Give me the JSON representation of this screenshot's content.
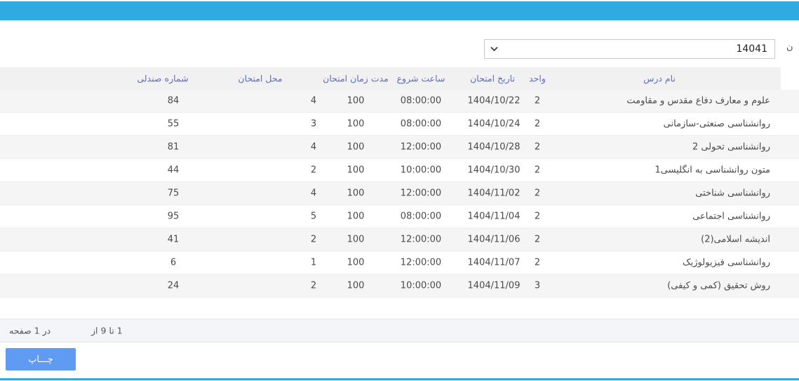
{
  "topbar": {
    "color": "#31a9e1"
  },
  "filter": {
    "semester_value": "14041",
    "label_fragment": "ن"
  },
  "table": {
    "columns": [
      {
        "key": "course",
        "label": "نام درس"
      },
      {
        "key": "units",
        "label": "واحد"
      },
      {
        "key": "date",
        "label": "تاریخ امتحان"
      },
      {
        "key": "start",
        "label": "ساعت شروع"
      },
      {
        "key": "duration",
        "label": "مدت زمان امتحان"
      },
      {
        "key": "location",
        "label": "محل امتحان"
      },
      {
        "key": "seat",
        "label": "شماره صندلی"
      }
    ],
    "rows": [
      {
        "course": "علوم و معارف دفاع مقدس و مقاومت",
        "units": "2",
        "date": "1404/10/22",
        "start": "08:00:00",
        "duration": "100",
        "location": "4",
        "seat": "84"
      },
      {
        "course": "روانشناسی صنعتی-سازمانی",
        "units": "2",
        "date": "1404/10/24",
        "start": "08:00:00",
        "duration": "100",
        "location": "3",
        "seat": "55"
      },
      {
        "course": "روانشناسی تحولی 2",
        "units": "2",
        "date": "1404/10/28",
        "start": "12:00:00",
        "duration": "100",
        "location": "4",
        "seat": "81"
      },
      {
        "course": "متون روانشناسی به انگلیسی1",
        "units": "2",
        "date": "1404/10/30",
        "start": "10:00:00",
        "duration": "100",
        "location": "2",
        "seat": "44"
      },
      {
        "course": "روانشناسی شناختی",
        "units": "2",
        "date": "1404/11/02",
        "start": "12:00:00",
        "duration": "100",
        "location": "4",
        "seat": "75"
      },
      {
        "course": "روانشناسی اجتماعی",
        "units": "2",
        "date": "1404/11/04",
        "start": "08:00:00",
        "duration": "100",
        "location": "5",
        "seat": "95"
      },
      {
        "course": "اندیشه اسلامی(2)",
        "units": "2",
        "date": "1404/11/06",
        "start": "12:00:00",
        "duration": "100",
        "location": "2",
        "seat": "41"
      },
      {
        "course": "روانشناسی فیزیولوژیک",
        "units": "2",
        "date": "1404/11/07",
        "start": "12:00:00",
        "duration": "100",
        "location": "1",
        "seat": "6"
      },
      {
        "course": "روش تحقیق (کمی و کیفی)",
        "units": "3",
        "date": "1404/11/09",
        "start": "10:00:00",
        "duration": "100",
        "location": "2",
        "seat": "24"
      }
    ]
  },
  "pager": {
    "range_text": "1 تا 9 از",
    "page_text": "در 1 صفحه"
  },
  "print_button": {
    "label": "چـــاپ"
  },
  "colors": {
    "topbar_blue": "#31a9e1",
    "header_text_blue": "#5b6fc0",
    "stripe_gray": "#f5f5f6",
    "button_blue": "#5f9bf2",
    "bottom_line_blue": "#3aa7de"
  }
}
